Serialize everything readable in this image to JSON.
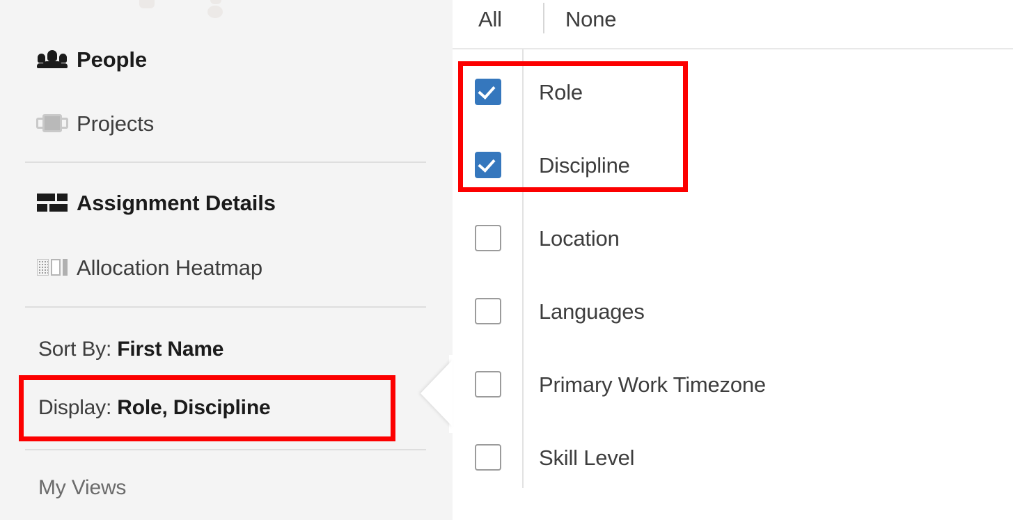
{
  "sidebar": {
    "nav_items": [
      {
        "label": "People",
        "icon": "people-group-icon",
        "active": true
      },
      {
        "label": "Projects",
        "icon": "projects-filmstrip-icon",
        "active": false
      },
      {
        "label": "Assignment Details",
        "icon": "bricks-grid-icon",
        "active": true
      },
      {
        "label": "Allocation Heatmap",
        "icon": "heatmap-cells-icon",
        "active": false
      }
    ],
    "options": [
      {
        "prefix": "Sort By: ",
        "value": "First Name"
      },
      {
        "prefix": "Display: ",
        "value": "Role, Discipline"
      }
    ],
    "my_views_label": "My Views"
  },
  "popup": {
    "select_all_label": "All",
    "select_none_label": "None",
    "items": [
      {
        "label": "Role",
        "checked": true
      },
      {
        "label": "Discipline",
        "checked": true
      },
      {
        "label": "Location",
        "checked": false
      },
      {
        "label": "Languages",
        "checked": false
      },
      {
        "label": "Primary Work Timezone",
        "checked": false
      },
      {
        "label": "Skill Level",
        "checked": false
      }
    ]
  },
  "annotations": {
    "highlight_color": "#fc0000",
    "boxes": [
      {
        "name": "display-option-highlight",
        "target": "Display: Role, Discipline"
      },
      {
        "name": "checked-fields-highlight",
        "target": "Role, Discipline checkboxes"
      }
    ]
  },
  "colors": {
    "sidebar_bg": "#f4f4f4",
    "popup_bg": "#ffffff",
    "checkbox_checked": "#3577bd",
    "text_primary": "#1b1b1b",
    "text_secondary": "#3d3d3d",
    "text_muted": "#6b6b6b",
    "divider": "#dedede"
  }
}
